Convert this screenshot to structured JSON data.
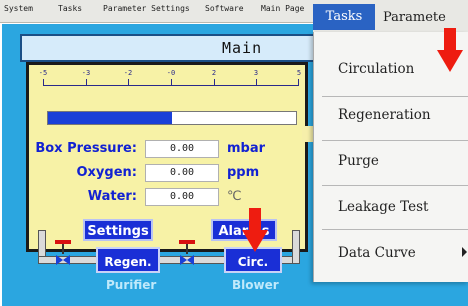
{
  "menubar": {
    "items": [
      "System",
      "Tasks",
      "Parameter Settings",
      "Software",
      "Main Page"
    ]
  },
  "main": {
    "title": "Main",
    "gauge": {
      "ticks": [
        "-5",
        "-3",
        "-2",
        "-0",
        "2",
        "3",
        "5"
      ],
      "level_fraction": 0.5
    },
    "readings": [
      {
        "label": "Box Pressure:",
        "value": "0.00",
        "unit": "mbar"
      },
      {
        "label": "Oxygen:",
        "value": "0.00",
        "unit": "ppm"
      },
      {
        "label": "Water:",
        "value": "0.00",
        "unit": "℃"
      }
    ],
    "settings_label": "Settings",
    "alarms_label": "Alarms",
    "process": {
      "regen_label": "Regen.",
      "circ_label": "Circ.",
      "purifier_label": "Purifier",
      "blower_label": "Blower"
    }
  },
  "dropdown": {
    "tasks_label": "Tasks",
    "param_label": "Paramete",
    "items": [
      "Circulation",
      "Regeneration",
      "Purge",
      "Leakage Test",
      "Data Curve"
    ]
  },
  "colors": {
    "panel_bg": "#2ba6e0",
    "gauge_bg": "#f7f2a6",
    "button_blue": "#1a2fd6",
    "highlight": "#2a63c3",
    "arrow_red": "#ee1c10"
  }
}
